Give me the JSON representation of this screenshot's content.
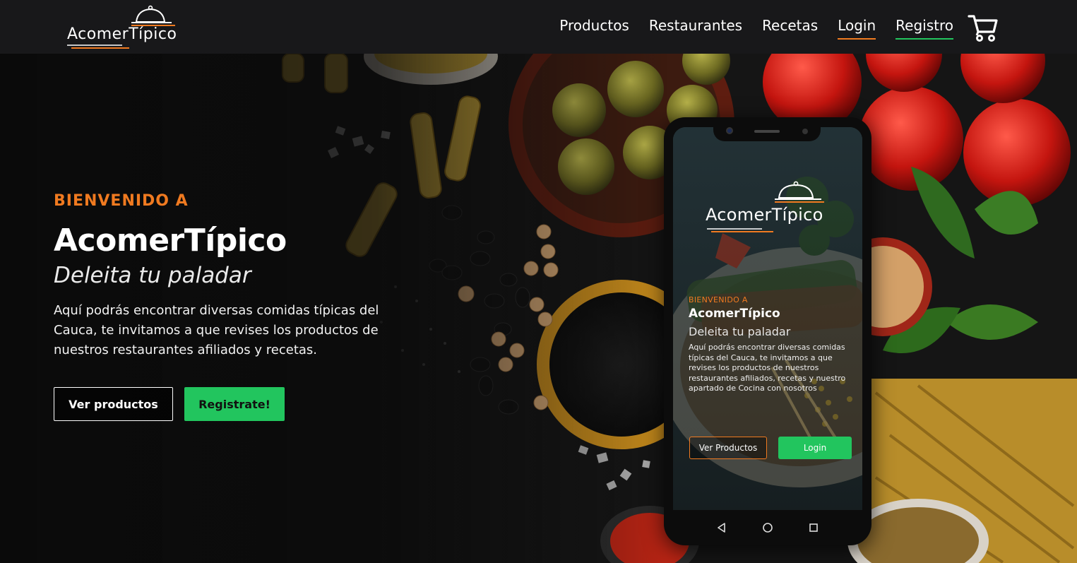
{
  "brand": {
    "name": "AcomerTípico",
    "accent_orange": "#f07a20",
    "accent_green": "#22c55e",
    "navbar_bg": "#18181a"
  },
  "nav": {
    "links": [
      {
        "label": "Productos"
      },
      {
        "label": "Restaurantes"
      },
      {
        "label": "Recetas"
      },
      {
        "label": "Login"
      },
      {
        "label": "Registro"
      }
    ],
    "cart_icon": "shopping-cart-icon"
  },
  "hero": {
    "eyebrow": "BIENVENIDO A",
    "title": "AcomerTípico",
    "subtitle": "Deleita tu paladar",
    "description": "Aquí podrás encontrar diversas comidas típicas del Cauca, te invitamos a que revises los productos de nuestros restaurantes afiliados y recetas.",
    "btn_products": "Ver productos",
    "btn_register": "Registrate!"
  },
  "phone": {
    "logo_text": "AcomerTípico",
    "eyebrow": "BIENVENIDO A",
    "title": "AcomerTípico",
    "subtitle": "Deleita tu paladar",
    "description": "Aquí podrás encontrar diversas comidas típicas del Cauca, te invitamos a que revises los productos de nuestros restaurantes afiliados, recetas y nuestro apartado de Cocina con nosotros",
    "btn_products": "Ver Productos",
    "btn_login": "Login",
    "nav_icons": [
      "back-icon",
      "home-icon",
      "recents-icon"
    ]
  }
}
